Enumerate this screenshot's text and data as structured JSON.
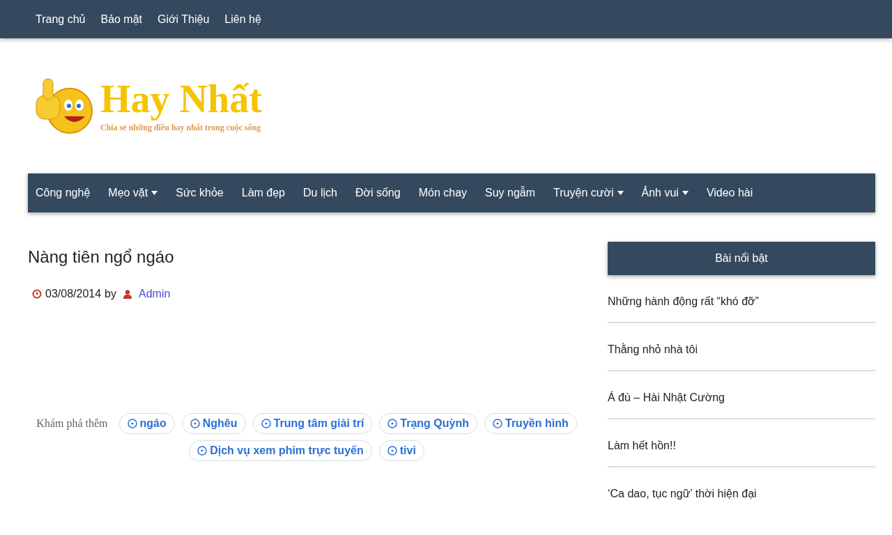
{
  "top_nav": [
    "Trang chủ",
    "Bảo mật",
    "Giới Thiệu",
    "Liên hệ"
  ],
  "logo": {
    "title": "Hay Nhất",
    "tagline": "Chia sẻ những điều hay nhất trong cuộc sống"
  },
  "main_nav": [
    {
      "label": "Công nghệ",
      "dropdown": false
    },
    {
      "label": "Mẹo vặt",
      "dropdown": true
    },
    {
      "label": "Sức khỏe",
      "dropdown": false
    },
    {
      "label": "Làm đẹp",
      "dropdown": false
    },
    {
      "label": "Du lịch",
      "dropdown": false
    },
    {
      "label": "Đời sống",
      "dropdown": false
    },
    {
      "label": "Món chay",
      "dropdown": false
    },
    {
      "label": "Suy ngẫm",
      "dropdown": false
    },
    {
      "label": "Truyện cười",
      "dropdown": true
    },
    {
      "label": "Ảnh vui",
      "dropdown": true
    },
    {
      "label": "Video hài",
      "dropdown": false
    }
  ],
  "post": {
    "title": "Nàng tiên ngổ ngáo",
    "date": "03/08/2014",
    "by": "by",
    "author": "Admin"
  },
  "explore": {
    "label": "Khám phá thêm",
    "tags": [
      "ngáo",
      "Nghêu",
      "Trung tâm giải trí",
      "Trạng Quỳnh",
      "Truyền hình",
      "Dịch vụ xem phim trực tuyến",
      "tivi"
    ]
  },
  "sidebar": {
    "title": "Bài nổi bật",
    "items": [
      "Những hành động rất “khó đỡ”",
      "Thằng nhỏ nhà tôi",
      "Á đù – Hài Nhật Cường",
      "Làm hết hồn!!",
      "‘Ca dao, tục ngữ’ thời hiện đại"
    ]
  }
}
